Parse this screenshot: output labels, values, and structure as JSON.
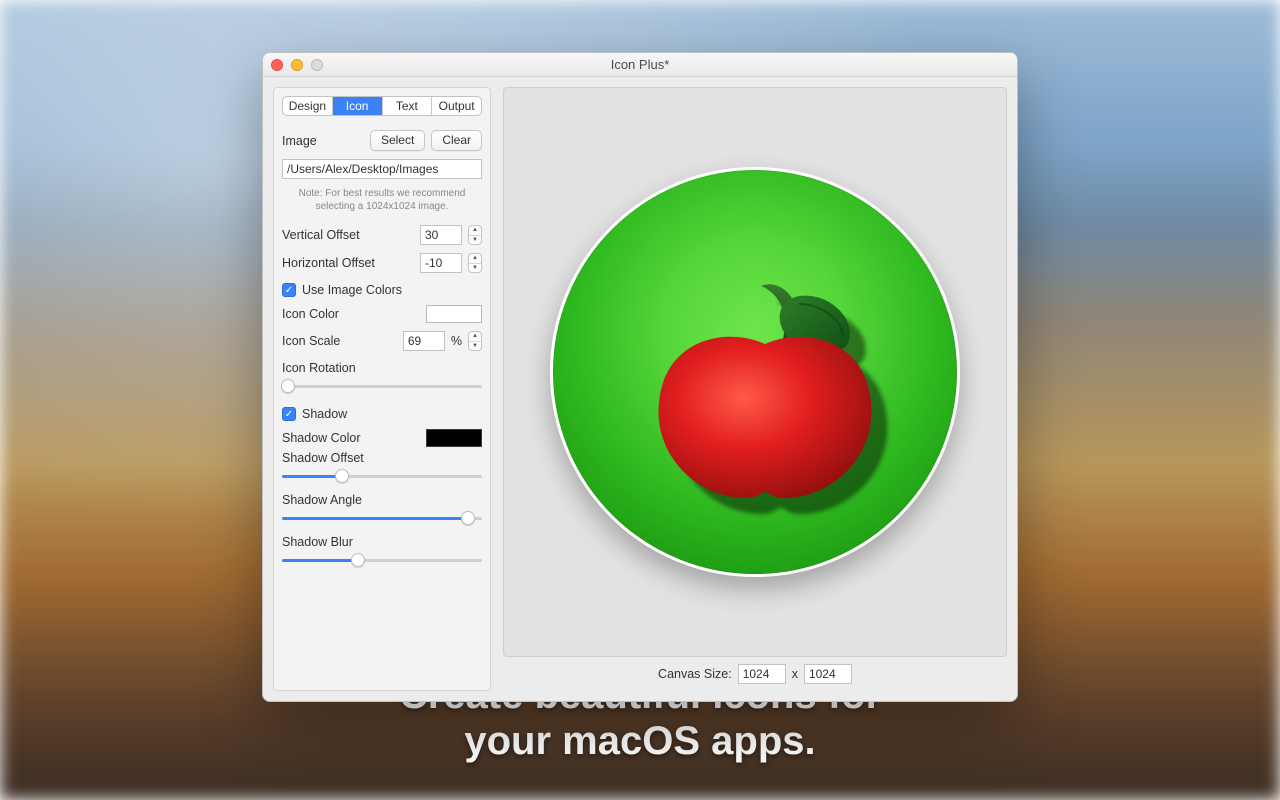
{
  "window": {
    "title": "Icon Plus*"
  },
  "tabs": [
    "Design",
    "Icon",
    "Text",
    "Output"
  ],
  "active_tab": "Icon",
  "image": {
    "label": "Image",
    "select_btn": "Select",
    "clear_btn": "Clear",
    "path": "/Users/Alex/Desktop/Images",
    "note": "Note: For best results we recommend selecting a 1024x1024 image."
  },
  "offsets": {
    "vertical_label": "Vertical Offset",
    "vertical_value": "30",
    "horizontal_label": "Horizontal Offset",
    "horizontal_value": "-10"
  },
  "use_image_colors": {
    "label": "Use Image Colors",
    "checked": true
  },
  "icon_color": {
    "label": "Icon Color",
    "value": "#ffffff"
  },
  "icon_scale": {
    "label": "Icon Scale",
    "value": "69",
    "unit": "%"
  },
  "icon_rotation": {
    "label": "Icon Rotation",
    "percent": 3
  },
  "shadow": {
    "checkbox_label": "Shadow",
    "checked": true,
    "color_label": "Shadow Color",
    "color_value": "#000000",
    "offset_label": "Shadow Offset",
    "offset_percent": 30,
    "angle_label": "Shadow Angle",
    "angle_percent": 93,
    "blur_label": "Shadow Blur",
    "blur_percent": 38
  },
  "canvas": {
    "label": "Canvas Size:",
    "width": "1024",
    "sep": "x",
    "height": "1024"
  },
  "caption": "Create beautiful icons for\nyour macOS apps."
}
